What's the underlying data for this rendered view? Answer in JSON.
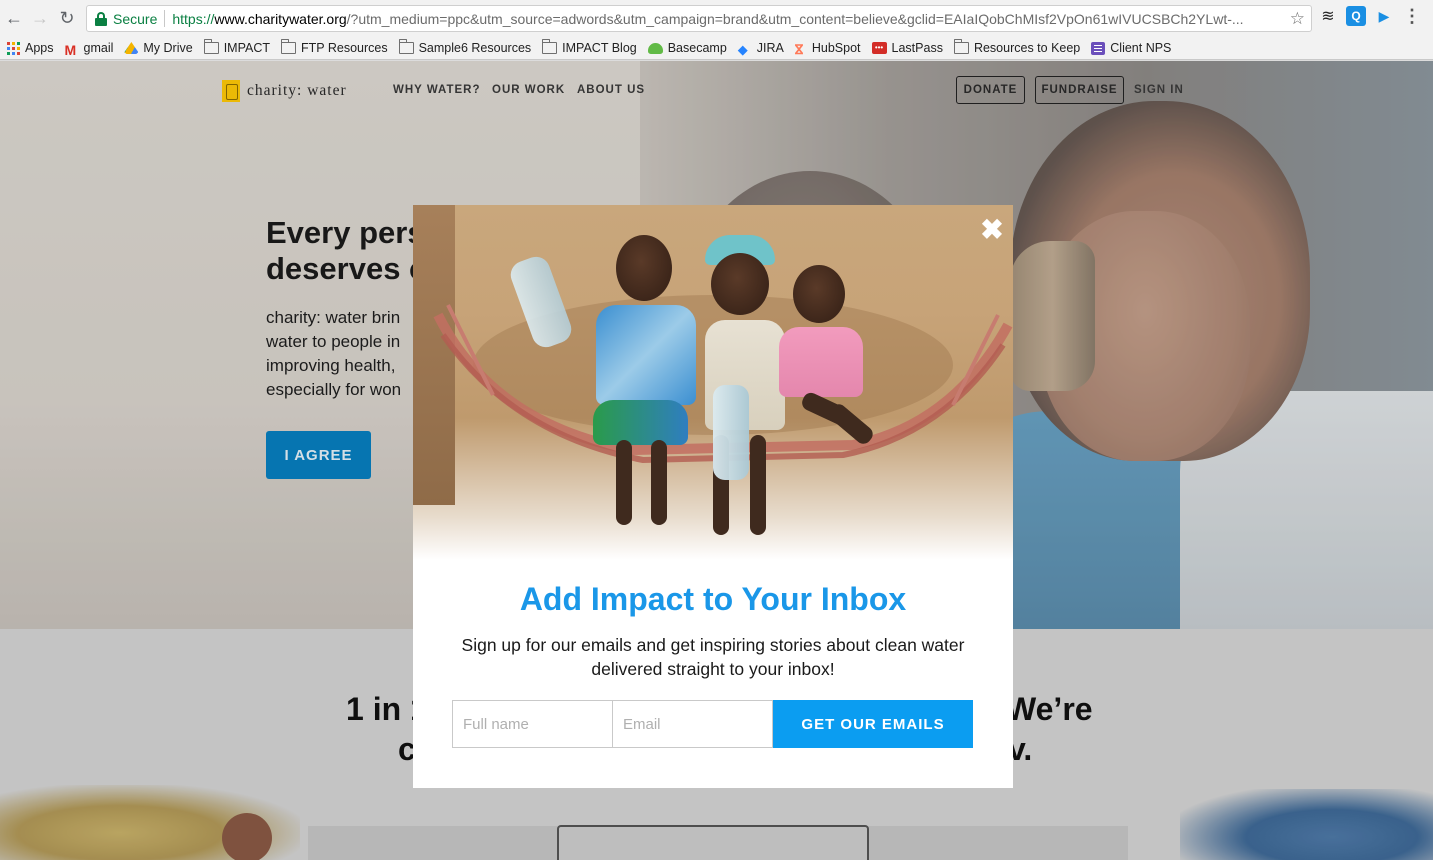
{
  "browser": {
    "secure_label": "Secure",
    "url_scheme": "https://",
    "url_host": "www.charitywater.org",
    "url_rest": "/?utm_medium=ppc&utm_source=adwords&utm_campaign=brand&utm_content=believe&gclid=EAIaIQobChMIsf2VpOn61wIVUCSBCh2YLwt-...",
    "bookmarks": [
      {
        "label": "Apps",
        "icon": "apps-icon"
      },
      {
        "label": "gmail",
        "icon": "gmail-icon"
      },
      {
        "label": "My Drive",
        "icon": "drive-icon"
      },
      {
        "label": "IMPACT",
        "icon": "folder-icon"
      },
      {
        "label": "FTP Resources",
        "icon": "folder-icon"
      },
      {
        "label": "Sample6 Resources",
        "icon": "folder-icon"
      },
      {
        "label": "IMPACT Blog",
        "icon": "folder-icon"
      },
      {
        "label": "Basecamp",
        "icon": "basecamp-icon"
      },
      {
        "label": "JIRA",
        "icon": "jira-icon"
      },
      {
        "label": "HubSpot",
        "icon": "hubspot-icon"
      },
      {
        "label": "LastPass",
        "icon": "lastpass-icon"
      },
      {
        "label": "Resources to Keep",
        "icon": "folder-icon"
      },
      {
        "label": "Client NPS",
        "icon": "client-nps-icon"
      }
    ]
  },
  "site": {
    "logo_text": "charity: water",
    "nav": {
      "why_water": "WHY WATER?",
      "our_work": "OUR WORK",
      "about_us": "ABOUT US",
      "donate": "DONATE",
      "fundraise": "FUNDRAISE",
      "sign_in": "SIGN IN"
    },
    "hero": {
      "headline_line1": "Every pers",
      "headline_line2": "deserves c",
      "body_lines": [
        "charity: water brin",
        "water to people in",
        "improving health,",
        "especially for won"
      ],
      "agree_label": "I AGREE"
    },
    "stat": {
      "line1_left": "1 in 1",
      "line1_right": "We’re",
      "line2_left": "c",
      "line2_right": "v."
    }
  },
  "modal": {
    "close_glyph": "✖",
    "title": "Add Impact to Your Inbox",
    "subtitle": "Sign up for our emails and get inspiring stories about clean water delivered straight to your inbox!",
    "name_placeholder": "Full name",
    "email_placeholder": "Email",
    "submit_label": "GET OUR EMAILS"
  },
  "colors": {
    "accent_blue": "#1a97e8",
    "button_blue": "#0b9df1",
    "agree_blue": "#077fc1",
    "logo_yellow": "#ffc907",
    "secure_green": "#0b8043"
  }
}
